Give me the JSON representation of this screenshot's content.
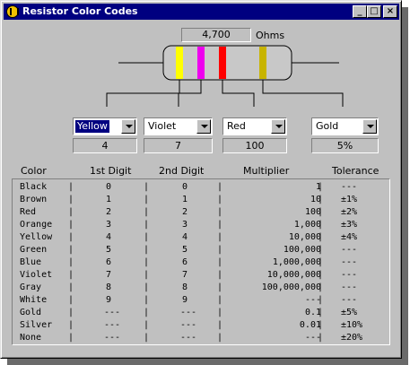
{
  "window": {
    "title": "Resistor Color Codes",
    "controls": [
      "_",
      "□",
      "×"
    ]
  },
  "resistance": {
    "value": "4,700",
    "unit": "Ohms"
  },
  "resistor": {
    "body_color": "#c8c8c8",
    "bands": [
      "#ffff00",
      "#ee00ee",
      "#ff0000",
      "#c8b400"
    ]
  },
  "selectors": [
    {
      "label": "1st Digit",
      "selected": "Yellow",
      "value": "4"
    },
    {
      "label": "2nd Digit",
      "selected": "Violet",
      "value": "7"
    },
    {
      "label": "Multiplier",
      "selected": "Red",
      "value": "100"
    },
    {
      "label": "Tolerance",
      "selected": "Gold",
      "value": "5%"
    }
  ],
  "table": {
    "headers": [
      "Color",
      "1st Digit",
      "2nd Digit",
      "Multiplier",
      "Tolerance"
    ],
    "rows": [
      [
        "Black",
        "0",
        "0",
        "1",
        "---"
      ],
      [
        "Brown",
        "1",
        "1",
        "10",
        "±1%"
      ],
      [
        "Red",
        "2",
        "2",
        "100",
        "±2%"
      ],
      [
        "Orange",
        "3",
        "3",
        "1,000",
        "±3%"
      ],
      [
        "Yellow",
        "4",
        "4",
        "10,000",
        "±4%"
      ],
      [
        "Green",
        "5",
        "5",
        "100,000",
        "---"
      ],
      [
        "Blue",
        "6",
        "6",
        "1,000,000",
        "---"
      ],
      [
        "Violet",
        "7",
        "7",
        "10,000,000",
        "---"
      ],
      [
        "Gray",
        "8",
        "8",
        "100,000,000",
        "---"
      ],
      [
        "White",
        "9",
        "9",
        "---",
        "---"
      ],
      [
        "Gold",
        "---",
        "---",
        "0.1",
        "±5%"
      ],
      [
        "Silver",
        "---",
        "---",
        "0.01",
        "±10%"
      ],
      [
        "None",
        "---",
        "---",
        "---",
        "±20%"
      ]
    ]
  }
}
